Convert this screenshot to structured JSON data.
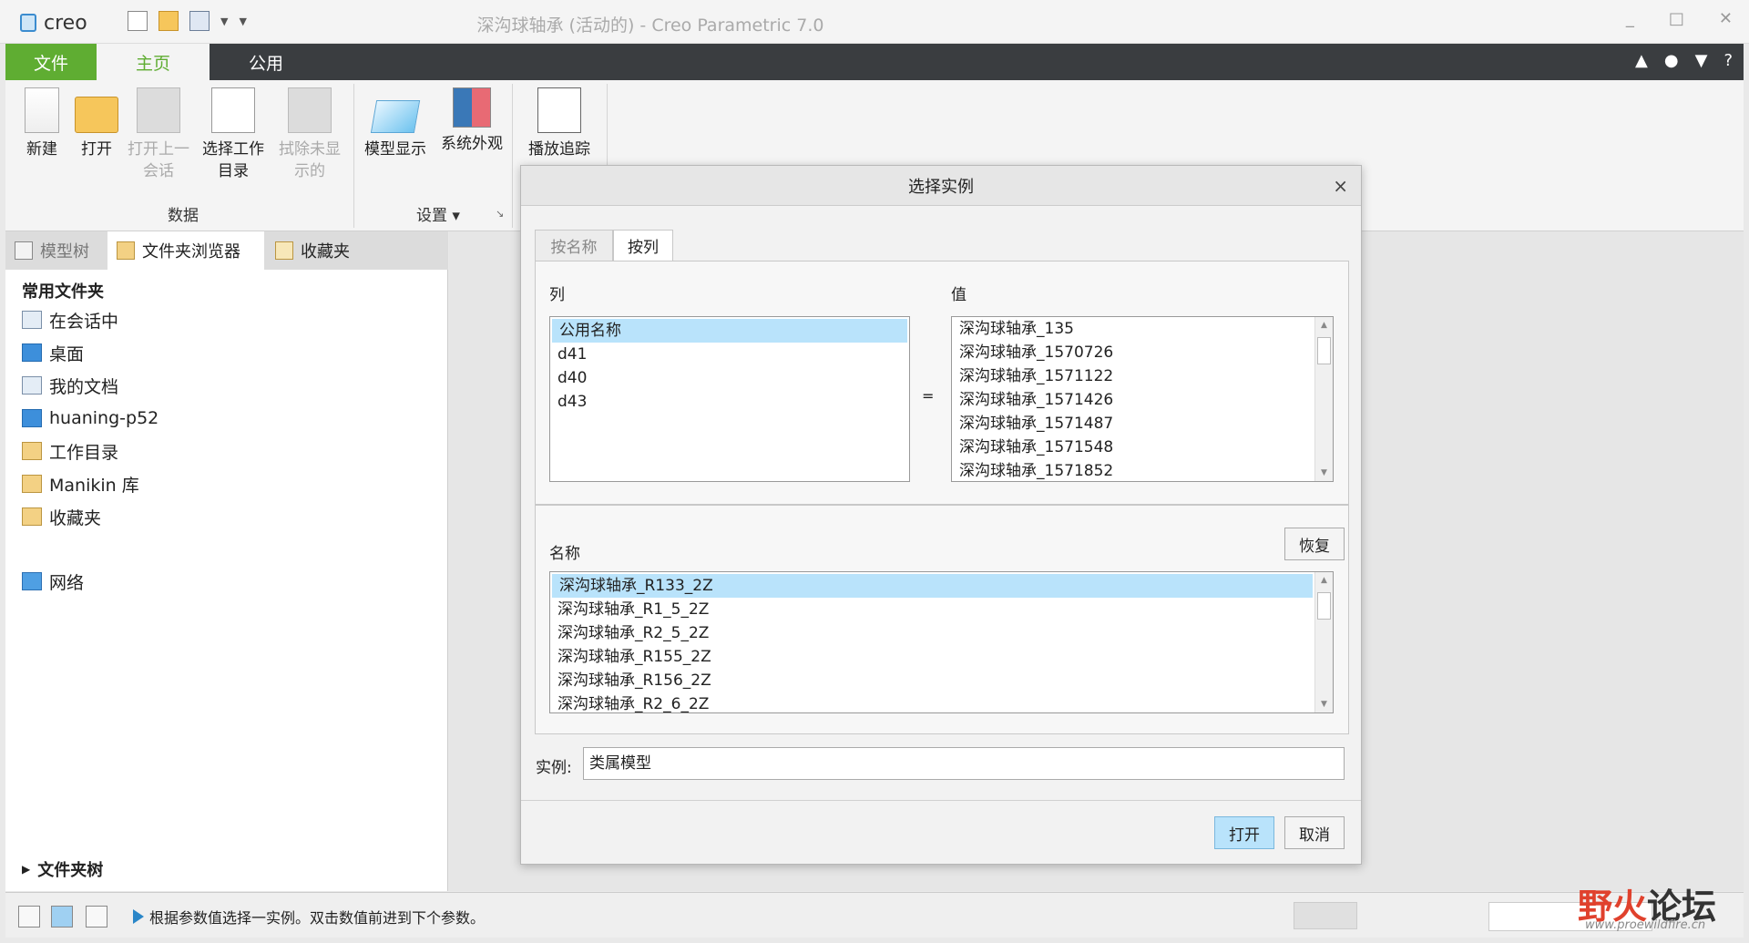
{
  "app": {
    "logo_text": "creo",
    "window_title": "深沟球轴承 (活动的) - Creo Parametric 7.0",
    "window_controls": [
      "_",
      "□",
      "✕"
    ]
  },
  "ribbon": {
    "tabs": [
      "文件",
      "主页",
      "公用"
    ],
    "right_icons": [
      "▲",
      "●",
      "▼",
      "?"
    ],
    "buttons": {
      "new": "新建",
      "open": "打开",
      "open_last_1": "打开上一",
      "open_last_2": "会话",
      "select_wd_1": "选择工作",
      "select_wd_2": "目录",
      "erase_1": "拭除未显",
      "erase_2": "示的",
      "model_display": "模型显示",
      "system_appearance": "系统外观",
      "playback_trail": "播放追踪"
    },
    "groups": {
      "data": "数据",
      "settings": "设置 ▾"
    }
  },
  "left_panel": {
    "tabs": [
      "模型树",
      "文件夹浏览器",
      "收藏夹"
    ],
    "heading": "常用文件夹",
    "items": [
      "在会话中",
      "桌面",
      "我的文档",
      "huaning-p52",
      "工作目录",
      "Manikin 库",
      "收藏夹",
      "网络"
    ],
    "footer": "文件夹树"
  },
  "dialog": {
    "title": "选择实例",
    "close": "×",
    "tabs": [
      "按名称",
      "按列"
    ],
    "column_label": "列",
    "value_label": "值",
    "equals": "=",
    "columns": [
      "公用名称",
      "d41",
      "d40",
      "d43"
    ],
    "values": [
      "深沟球轴承_135",
      "深沟球轴承_1570726",
      "深沟球轴承_1571122",
      "深沟球轴承_1571426",
      "深沟球轴承_1571487",
      "深沟球轴承_1571548",
      "深沟球轴承_1571852"
    ],
    "name_label": "名称",
    "restore_button": "恢复",
    "names": [
      "深沟球轴承_R133_2Z",
      "深沟球轴承_R1_5_2Z",
      "深沟球轴承_R2_5_2Z",
      "深沟球轴承_R155_2Z",
      "深沟球轴承_R156_2Z",
      "深沟球轴承_R2_6_2Z"
    ],
    "instance_label": "实例:",
    "instance_value": "类属模型",
    "open_button": "打开",
    "cancel_button": "取消"
  },
  "status": {
    "message": "根据参数值选择一实例。双击数值前进到下个参数。"
  },
  "watermark": {
    "text_red": "野火",
    "text_dark": "论坛",
    "url": "www.proewildfire.cn"
  }
}
